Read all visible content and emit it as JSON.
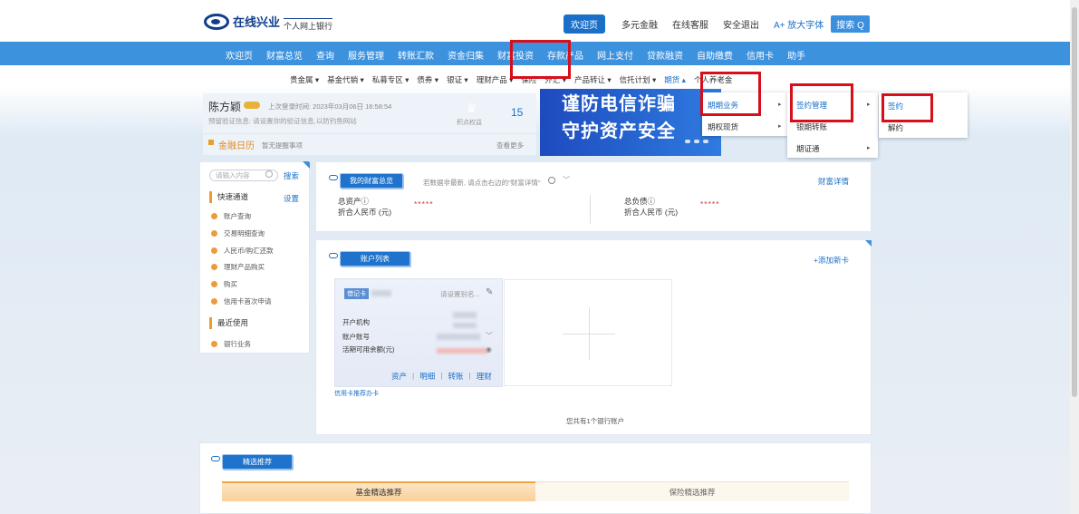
{
  "header": {
    "logo_brand": "在线兴业",
    "logo_sub": "个人网上银行",
    "links": [
      "欢迎页",
      "多元金融",
      "在线客服",
      "安全退出"
    ],
    "font_size": "A+ 放大字体",
    "search": "搜索 Q"
  },
  "main_nav": [
    "欢迎页",
    "财富总览",
    "查询",
    "服务管理",
    "转账汇款",
    "资金归集",
    "财富投资",
    "存款产品",
    "网上支付",
    "贷款融资",
    "自助缴费",
    "信用卡",
    "助手"
  ],
  "sub_nav": [
    "贵金属 ▾",
    "基金代销 ▾",
    "私募专区 ▾",
    "债券 ▾",
    "银证 ▾",
    "理财产品 ▾",
    "保险",
    "外汇 ▾",
    "产品转让 ▾",
    "信托计划 ▾",
    "期货 ▴",
    "个人养老金"
  ],
  "user": {
    "name": "陈方颖",
    "last_login": "上次登录时间: 2023年03月06日 16:58:54",
    "verify": "预留验证信息: 请设置你的验证信息,以防钓鱼网站",
    "points": "15",
    "points_label": "积点权益",
    "calendar_title": "金融日历",
    "calendar_note": "暂无提醒事项",
    "calendar_more": "查看更多"
  },
  "banner": {
    "line1": "谨防电信诈骗",
    "line2": "守护资产安全"
  },
  "dropdowns": {
    "futures": [
      "期期业务",
      "期权现货"
    ],
    "business": [
      "签约管理",
      "银期转账",
      "期证通"
    ],
    "sign": [
      "签约",
      "解约"
    ]
  },
  "sidebar": {
    "search_placeholder": "请输入内容",
    "search_btn": "搜索",
    "quick_title": "快速通道",
    "settings": "设置",
    "quick_items": [
      "账户查询",
      "交易明细查询",
      "人民币/购汇还款",
      "理财产品购买",
      "购买",
      "信用卡首次申请"
    ],
    "recent_title": "最近使用",
    "recent_items": [
      "银行业务"
    ]
  },
  "wealth": {
    "tag": "我的财富总览",
    "hint": "若数据非最新, 请点击右边的\"财富详情\"",
    "detail": "财富详情",
    "assets_label": "总资产ⓘ",
    "assets_unit": "折合人民币 (元)",
    "assets_value": "*****",
    "debt_label": "总负债ⓘ",
    "debt_unit": "折合人民币 (元)",
    "debt_value": "*****"
  },
  "accounts": {
    "tag": "账户列表",
    "add": "+添加新卡",
    "card_type": "借记卡",
    "alias": "请设置别名...",
    "rows": [
      "开户机构",
      "账户账号",
      "活期可用余额(元)"
    ],
    "links": [
      "资产",
      "明细",
      "转账",
      "理财"
    ],
    "promo": "信用卡推荐办卡",
    "count": "您共有1个银行账户"
  },
  "recommend": {
    "tag": "精选推荐",
    "tabs": [
      "基金精选推荐",
      "保险精选推荐"
    ]
  }
}
